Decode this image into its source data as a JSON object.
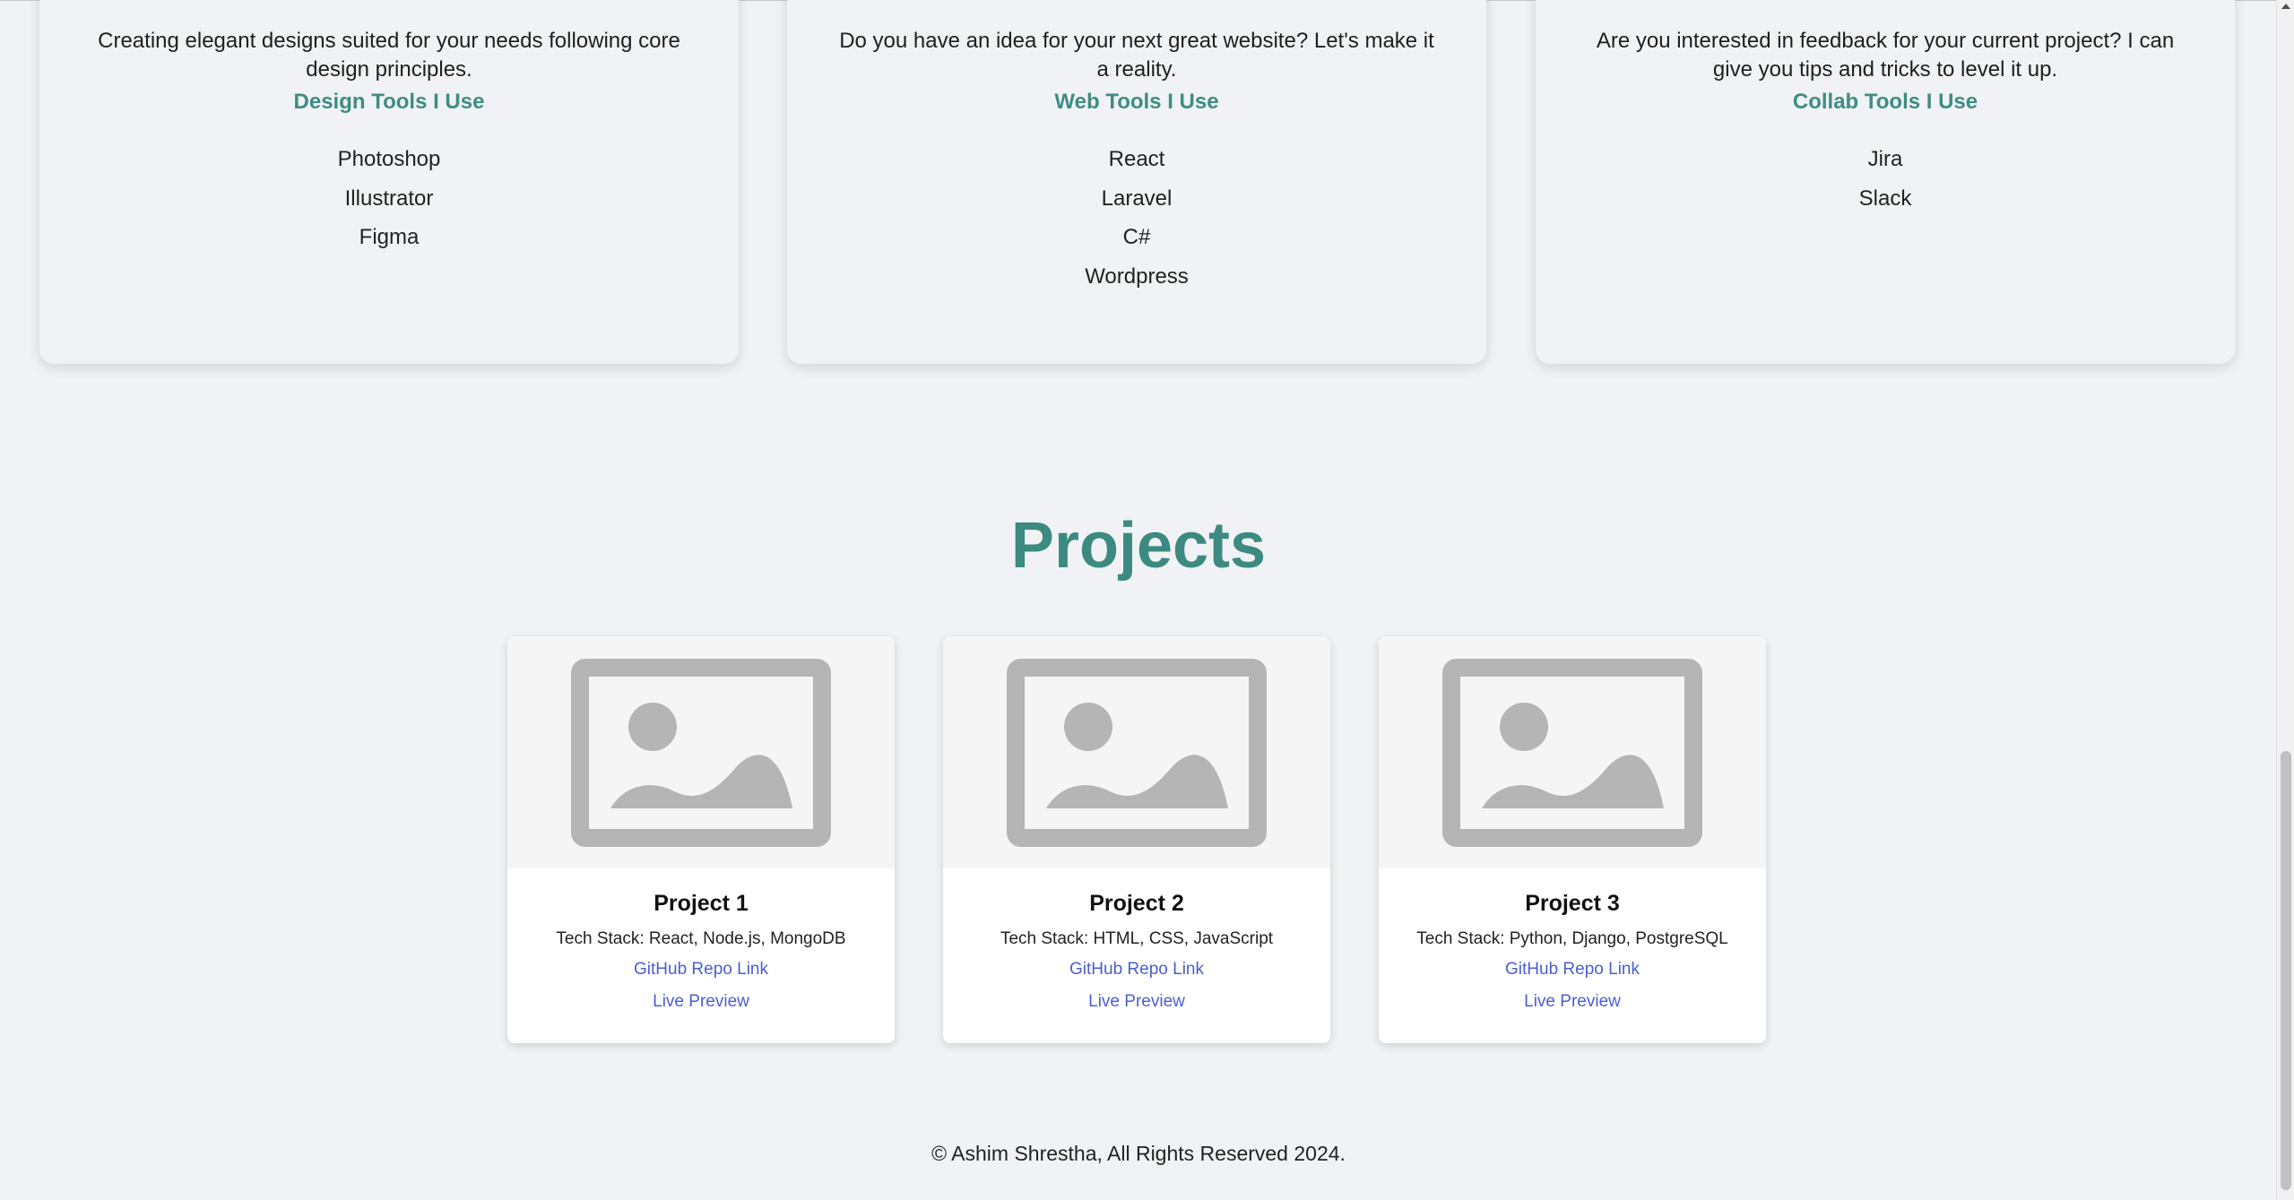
{
  "services": [
    {
      "description": "Creating elegant designs suited for your needs following core design principles.",
      "tools_title": "Design Tools I Use",
      "tools": [
        "Photoshop",
        "Illustrator",
        "Figma"
      ]
    },
    {
      "description": "Do you have an idea for your next great website? Let's make it a reality.",
      "tools_title": "Web Tools I Use",
      "tools": [
        "React",
        "Laravel",
        "C#",
        "Wordpress"
      ]
    },
    {
      "description": "Are you interested in feedback for your current project? I can give you tips and tricks to level it up.",
      "tools_title": "Collab Tools I Use",
      "tools": [
        "Jira",
        "Slack"
      ]
    }
  ],
  "projects_title": "Projects",
  "projects": [
    {
      "title": "Project 1",
      "tech_stack": "Tech Stack: React, Node.js, MongoDB",
      "repo_link": "GitHub Repo Link",
      "preview_link": "Live Preview"
    },
    {
      "title": "Project 2",
      "tech_stack": "Tech Stack: HTML, CSS, JavaScript",
      "repo_link": "GitHub Repo Link",
      "preview_link": "Live Preview"
    },
    {
      "title": "Project 3",
      "tech_stack": "Tech Stack: Python, Django, PostgreSQL",
      "repo_link": "GitHub Repo Link",
      "preview_link": "Live Preview"
    }
  ],
  "footer": "© Ashim Shrestha, All Rights Reserved 2024.",
  "icons": {
    "project_thumbnail": "image-placeholder-icon"
  },
  "colors": {
    "accent": "#3c8a80",
    "link": "#4a5fd0",
    "background": "#f0f2f5"
  }
}
